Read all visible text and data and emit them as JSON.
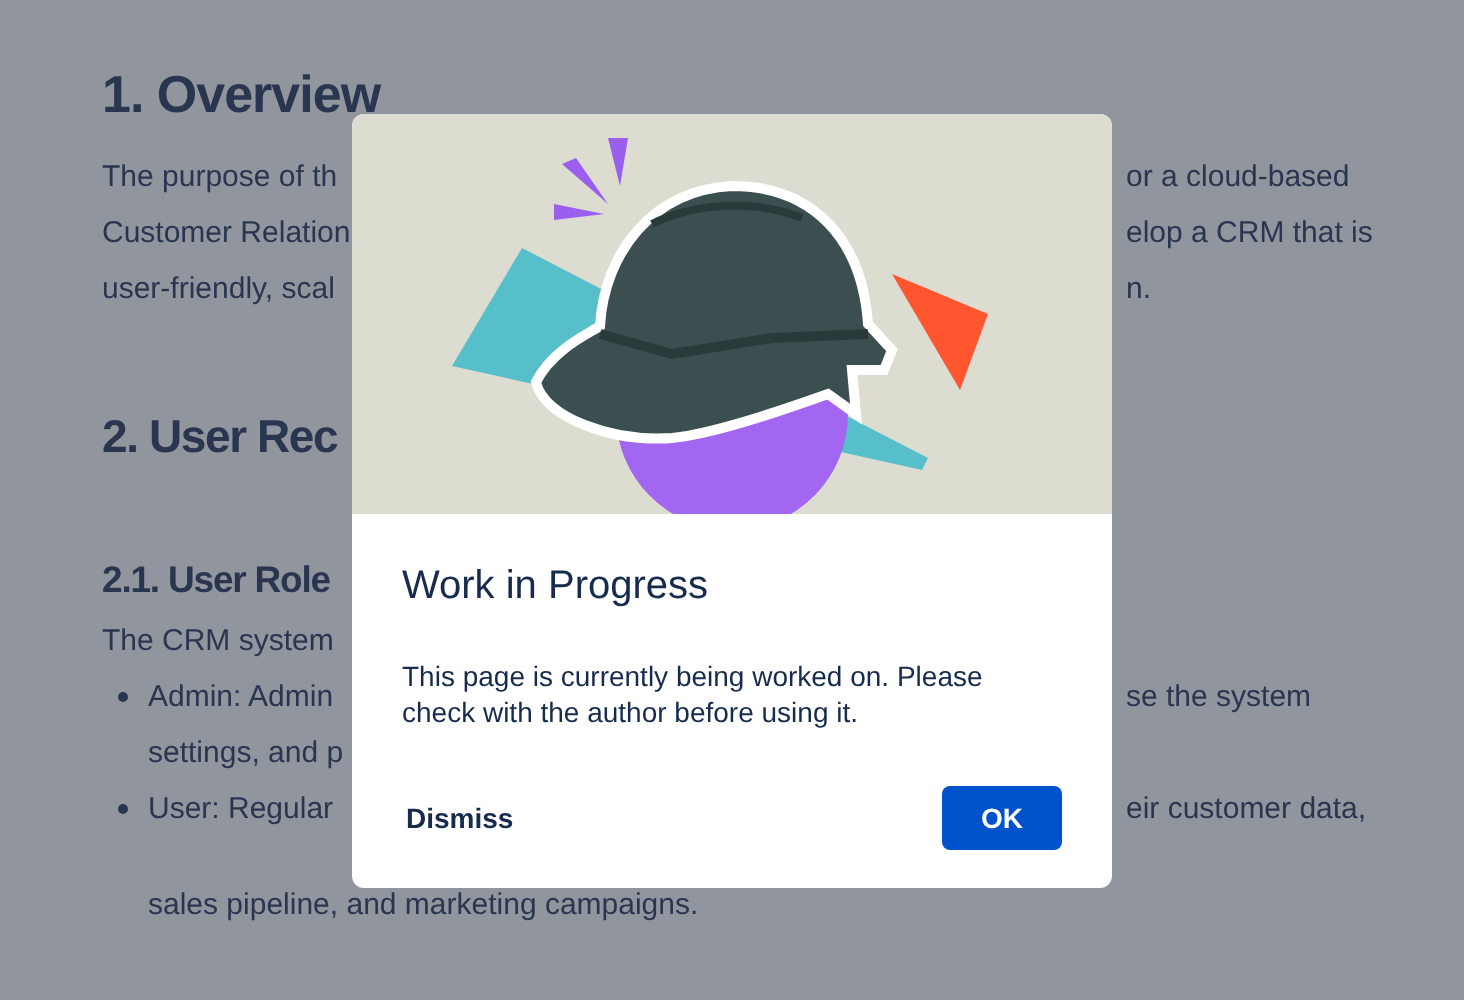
{
  "page": {
    "lines": [
      {
        "kind": "h1",
        "left": "1. Overview"
      },
      {
        "kind": "text",
        "left": "The purpose of th",
        "right": "or a cloud-based"
      },
      {
        "kind": "text",
        "left": "Customer Relation",
        "right": "elop a CRM that is"
      },
      {
        "kind": "text",
        "left": "user-friendly, scal",
        "right": "n."
      },
      {
        "kind": "h2",
        "left": "2. User Rec"
      },
      {
        "kind": "h3",
        "left": "2.1. User Role"
      },
      {
        "kind": "text",
        "left": "The CRM system"
      },
      {
        "kind": "bullet",
        "left": "Admin: Admin",
        "right": "se the system"
      },
      {
        "kind": "cont",
        "left": "settings, and p"
      },
      {
        "kind": "bullet",
        "left": "User: Regular",
        "right": "eir customer data,"
      },
      {
        "kind": "cont",
        "left": "sales pipeline, and marketing campaigns."
      }
    ]
  },
  "dialog": {
    "title": "Work in Progress",
    "message": "This page is currently being worked on. Please check with the author before using it.",
    "buttons": [
      {
        "label": "Dismiss",
        "kind": "subtle"
      },
      {
        "label": "OK",
        "kind": "primary"
      }
    ]
  }
}
